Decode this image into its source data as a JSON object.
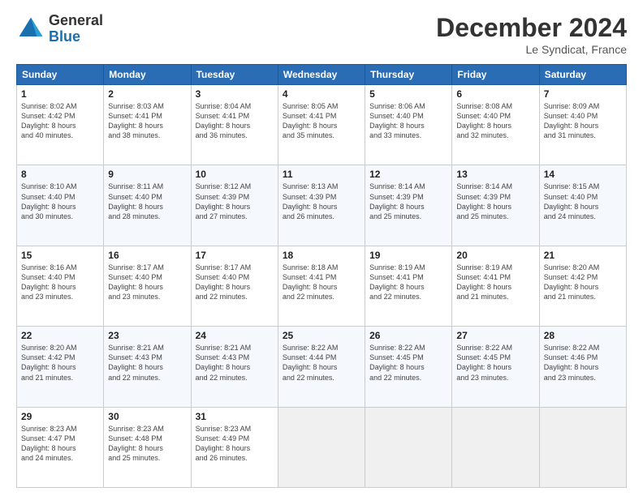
{
  "logo": {
    "general": "General",
    "blue": "Blue"
  },
  "header": {
    "month": "December 2024",
    "location": "Le Syndicat, France"
  },
  "days_of_week": [
    "Sunday",
    "Monday",
    "Tuesday",
    "Wednesday",
    "Thursday",
    "Friday",
    "Saturday"
  ],
  "weeks": [
    [
      {
        "day": "1",
        "info": "Sunrise: 8:02 AM\nSunset: 4:42 PM\nDaylight: 8 hours\nand 40 minutes."
      },
      {
        "day": "2",
        "info": "Sunrise: 8:03 AM\nSunset: 4:41 PM\nDaylight: 8 hours\nand 38 minutes."
      },
      {
        "day": "3",
        "info": "Sunrise: 8:04 AM\nSunset: 4:41 PM\nDaylight: 8 hours\nand 36 minutes."
      },
      {
        "day": "4",
        "info": "Sunrise: 8:05 AM\nSunset: 4:41 PM\nDaylight: 8 hours\nand 35 minutes."
      },
      {
        "day": "5",
        "info": "Sunrise: 8:06 AM\nSunset: 4:40 PM\nDaylight: 8 hours\nand 33 minutes."
      },
      {
        "day": "6",
        "info": "Sunrise: 8:08 AM\nSunset: 4:40 PM\nDaylight: 8 hours\nand 32 minutes."
      },
      {
        "day": "7",
        "info": "Sunrise: 8:09 AM\nSunset: 4:40 PM\nDaylight: 8 hours\nand 31 minutes."
      }
    ],
    [
      {
        "day": "8",
        "info": "Sunrise: 8:10 AM\nSunset: 4:40 PM\nDaylight: 8 hours\nand 30 minutes."
      },
      {
        "day": "9",
        "info": "Sunrise: 8:11 AM\nSunset: 4:40 PM\nDaylight: 8 hours\nand 28 minutes."
      },
      {
        "day": "10",
        "info": "Sunrise: 8:12 AM\nSunset: 4:39 PM\nDaylight: 8 hours\nand 27 minutes."
      },
      {
        "day": "11",
        "info": "Sunrise: 8:13 AM\nSunset: 4:39 PM\nDaylight: 8 hours\nand 26 minutes."
      },
      {
        "day": "12",
        "info": "Sunrise: 8:14 AM\nSunset: 4:39 PM\nDaylight: 8 hours\nand 25 minutes."
      },
      {
        "day": "13",
        "info": "Sunrise: 8:14 AM\nSunset: 4:39 PM\nDaylight: 8 hours\nand 25 minutes."
      },
      {
        "day": "14",
        "info": "Sunrise: 8:15 AM\nSunset: 4:40 PM\nDaylight: 8 hours\nand 24 minutes."
      }
    ],
    [
      {
        "day": "15",
        "info": "Sunrise: 8:16 AM\nSunset: 4:40 PM\nDaylight: 8 hours\nand 23 minutes."
      },
      {
        "day": "16",
        "info": "Sunrise: 8:17 AM\nSunset: 4:40 PM\nDaylight: 8 hours\nand 23 minutes."
      },
      {
        "day": "17",
        "info": "Sunrise: 8:17 AM\nSunset: 4:40 PM\nDaylight: 8 hours\nand 22 minutes."
      },
      {
        "day": "18",
        "info": "Sunrise: 8:18 AM\nSunset: 4:41 PM\nDaylight: 8 hours\nand 22 minutes."
      },
      {
        "day": "19",
        "info": "Sunrise: 8:19 AM\nSunset: 4:41 PM\nDaylight: 8 hours\nand 22 minutes."
      },
      {
        "day": "20",
        "info": "Sunrise: 8:19 AM\nSunset: 4:41 PM\nDaylight: 8 hours\nand 21 minutes."
      },
      {
        "day": "21",
        "info": "Sunrise: 8:20 AM\nSunset: 4:42 PM\nDaylight: 8 hours\nand 21 minutes."
      }
    ],
    [
      {
        "day": "22",
        "info": "Sunrise: 8:20 AM\nSunset: 4:42 PM\nDaylight: 8 hours\nand 21 minutes."
      },
      {
        "day": "23",
        "info": "Sunrise: 8:21 AM\nSunset: 4:43 PM\nDaylight: 8 hours\nand 22 minutes."
      },
      {
        "day": "24",
        "info": "Sunrise: 8:21 AM\nSunset: 4:43 PM\nDaylight: 8 hours\nand 22 minutes."
      },
      {
        "day": "25",
        "info": "Sunrise: 8:22 AM\nSunset: 4:44 PM\nDaylight: 8 hours\nand 22 minutes."
      },
      {
        "day": "26",
        "info": "Sunrise: 8:22 AM\nSunset: 4:45 PM\nDaylight: 8 hours\nand 22 minutes."
      },
      {
        "day": "27",
        "info": "Sunrise: 8:22 AM\nSunset: 4:45 PM\nDaylight: 8 hours\nand 23 minutes."
      },
      {
        "day": "28",
        "info": "Sunrise: 8:22 AM\nSunset: 4:46 PM\nDaylight: 8 hours\nand 23 minutes."
      }
    ],
    [
      {
        "day": "29",
        "info": "Sunrise: 8:23 AM\nSunset: 4:47 PM\nDaylight: 8 hours\nand 24 minutes."
      },
      {
        "day": "30",
        "info": "Sunrise: 8:23 AM\nSunset: 4:48 PM\nDaylight: 8 hours\nand 25 minutes."
      },
      {
        "day": "31",
        "info": "Sunrise: 8:23 AM\nSunset: 4:49 PM\nDaylight: 8 hours\nand 26 minutes."
      },
      {
        "day": "",
        "info": ""
      },
      {
        "day": "",
        "info": ""
      },
      {
        "day": "",
        "info": ""
      },
      {
        "day": "",
        "info": ""
      }
    ]
  ]
}
